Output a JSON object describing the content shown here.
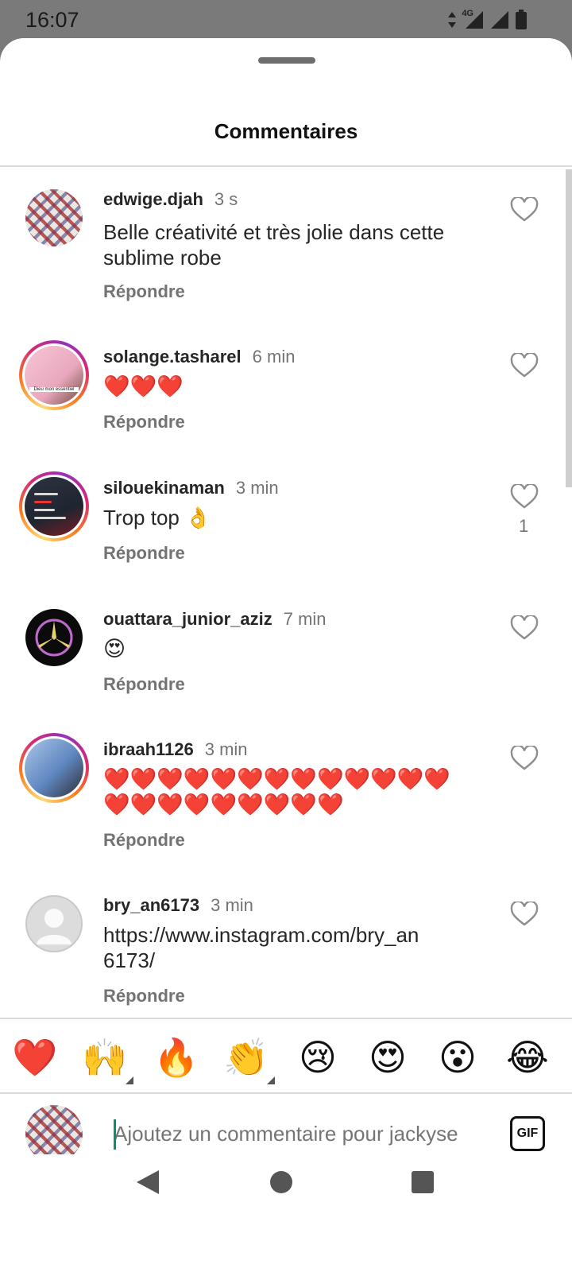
{
  "status_bar": {
    "time": "16:07",
    "network": "4G"
  },
  "sheet": {
    "title": "Commentaires"
  },
  "comments": [
    {
      "username": "edwige.djah",
      "time": "3 s",
      "text": "Belle créativité et très jolie dans cette sublime robe",
      "reply_label": "Répondre",
      "likes": ""
    },
    {
      "username": "solange.tasharel",
      "time": "6 min",
      "text": "❤️❤️❤️",
      "reply_label": "Répondre",
      "likes": "",
      "avatar_caption": "Dieu mon essentiel"
    },
    {
      "username": "silouekinaman",
      "time": "3 min",
      "text": "Trop top 👌",
      "reply_label": "Répondre",
      "likes": "1"
    },
    {
      "username": "ouattara_junior_aziz",
      "time": "7 min",
      "text": "😍",
      "reply_label": "Répondre",
      "likes": ""
    },
    {
      "username": "ibraah1126",
      "time": "3 min",
      "text": "❤️❤️❤️❤️❤️❤️❤️❤️❤️❤️❤️❤️❤️❤️❤️❤️❤️❤️❤️❤️❤️❤️",
      "reply_label": "Répondre",
      "likes": ""
    },
    {
      "username": "bry_an6173",
      "time": "3 min",
      "text": "https://www.instagram.com/bry_an6173/",
      "reply_label": "Répondre",
      "likes": ""
    }
  ],
  "reactions": [
    "❤️",
    "🙌",
    "🔥",
    "👏",
    "😢",
    "😍",
    "😮",
    "😂"
  ],
  "composer": {
    "placeholder": "Ajoutez un commentaire pour jackyse",
    "gif_label": "GIF"
  },
  "icons": {
    "like": "heart-outline-icon",
    "back": "back-triangle-icon",
    "home": "home-circle-icon",
    "recents": "recents-square-icon"
  }
}
